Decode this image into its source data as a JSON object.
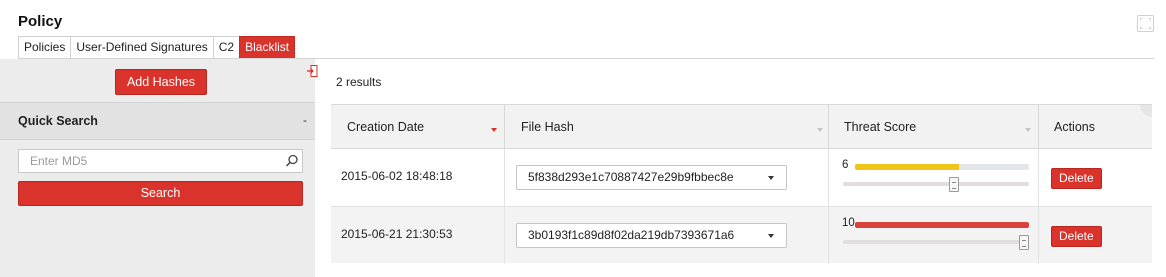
{
  "page": {
    "title": "Policy"
  },
  "tabs": [
    {
      "label": "Policies",
      "active": false
    },
    {
      "label": "User-Defined Signatures",
      "active": false
    },
    {
      "label": "C2",
      "active": false
    },
    {
      "label": "Blacklist",
      "active": true
    }
  ],
  "left_panel": {
    "add_hashes_label": "Add Hashes",
    "quick_search": {
      "title": "Quick Search",
      "toggle": "-",
      "input_placeholder": "Enter MD5",
      "input_value": "",
      "search_label": "Search"
    }
  },
  "results": {
    "count_text": "2 results",
    "columns": {
      "creation_date": "Creation Date",
      "file_hash": "File Hash",
      "threat_score": "Threat Score",
      "actions": "Actions"
    },
    "sort": {
      "column": "creation_date",
      "direction": "descending"
    },
    "score_max": 10,
    "rows": [
      {
        "creation_date": "2015-06-02 18:48:18",
        "file_hash": "5f838d293e1c70887427e29b9fbbec8e",
        "threat_score": 6,
        "threat_score_label": "6",
        "bar_color": "#f0c419",
        "action_label": "Delete"
      },
      {
        "creation_date": "2015-06-21 21:30:53",
        "file_hash": "3b0193f1c89d8f02da219db7393671a6",
        "threat_score": 10,
        "threat_score_label": "10",
        "bar_color": "#d9433c",
        "action_label": "Delete"
      }
    ]
  },
  "colors": {
    "accent": "#d9332b",
    "panel_bg": "#ececec",
    "header_bg": "#f2f2f2"
  },
  "icons": {
    "fullscreen": "fullscreen-icon",
    "collapse": "collapse-panel-icon",
    "search": "search-icon",
    "sort_desc": "sort-descending-icon",
    "dropdown": "chevron-down-icon"
  }
}
